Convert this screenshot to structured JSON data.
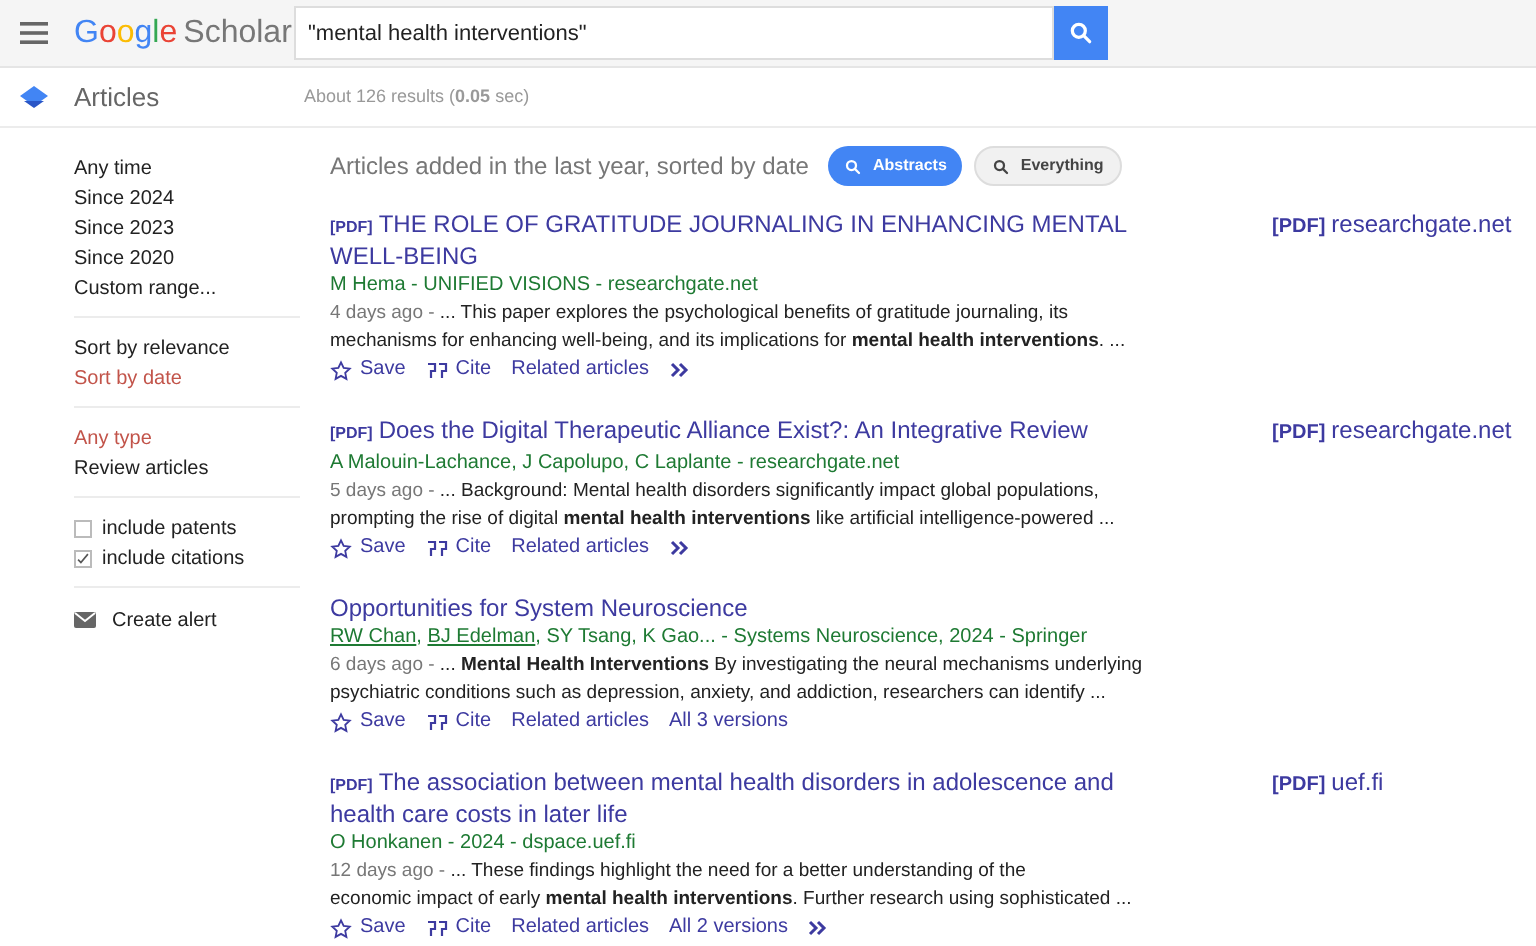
{
  "header": {
    "logo": {
      "brand": "Google",
      "product": "Scholar"
    },
    "search": {
      "value": "\"mental health interventions\""
    }
  },
  "subheader": {
    "section": "Articles",
    "stats": "About 126 results (**0.05** sec)"
  },
  "sidebar": {
    "groups": [
      {
        "kind": "links",
        "items": [
          {
            "label": "Any time",
            "selected": false
          },
          {
            "label": "Since 2024",
            "selected": false
          },
          {
            "label": "Since 2023",
            "selected": false
          },
          {
            "label": "Since 2020",
            "selected": false
          },
          {
            "label": "Custom range...",
            "selected": false
          }
        ]
      },
      {
        "kind": "links",
        "items": [
          {
            "label": "Sort by relevance",
            "selected": false
          },
          {
            "label": "Sort by date",
            "selected": true
          }
        ]
      },
      {
        "kind": "links",
        "items": [
          {
            "label": "Any type",
            "selected": true
          },
          {
            "label": "Review articles",
            "selected": false
          }
        ]
      },
      {
        "kind": "checks",
        "items": [
          {
            "label": "include patents",
            "checked": false
          },
          {
            "label": "include citations",
            "checked": true
          }
        ]
      },
      {
        "kind": "alert",
        "items": [
          {
            "label": "Create alert"
          }
        ]
      }
    ]
  },
  "results_header": {
    "text": "Articles added in the last year, sorted by date",
    "filters": [
      {
        "label": "Abstracts",
        "selected": true
      },
      {
        "label": "Everything",
        "selected": false
      }
    ]
  },
  "results": [
    {
      "tag": "[PDF]",
      "title": "THE ROLE OF GRATITUDE JOURNALING IN ENHANCING MENTAL WELL-BEING",
      "authors": [
        {
          "text": "M Hema - UNIFIED VISIONS - researchgate.net",
          "linked": false
        }
      ],
      "age": "4 days ago - ",
      "snippet_lines": [
        "... This paper explores the psychological benefits of gratitude journaling, its",
        "mechanisms for enhancing well-being, and its implications for **mental health interventions**. ..."
      ],
      "actions": [
        "Save",
        "Cite",
        "Related articles"
      ],
      "more": true,
      "side": {
        "tag": "[PDF]",
        "domain": "researchgate.net"
      }
    },
    {
      "tag": "[PDF]",
      "title": "Does the Digital Therapeutic Alliance Exist?: An Integrative Review",
      "authors": [
        {
          "text": "A Malouin-Lachance, J Capolupo, C Laplante - researchgate.net",
          "linked": false
        }
      ],
      "age": "5 days ago - ",
      "snippet_lines": [
        "... Background: Mental health disorders significantly impact global populations,",
        "prompting the rise of digital **mental health interventions** like artificial intelligence-powered ..."
      ],
      "actions": [
        "Save",
        "Cite",
        "Related articles"
      ],
      "more": true,
      "side": {
        "tag": "[PDF]",
        "domain": "researchgate.net"
      }
    },
    {
      "title": "Opportunities for System Neuroscience",
      "authors": [
        {
          "text": "RW Chan",
          "linked": true
        },
        {
          "text": ", ",
          "linked": false
        },
        {
          "text": "BJ Edelman",
          "linked": true
        },
        {
          "text": ", SY Tsang, K Gao... - Systems Neuroscience, 2024 - Springer",
          "linked": false
        }
      ],
      "age": "6 days ago - ",
      "snippet_lines": [
        "... **Mental Health Interventions** By investigating the neural mechanisms underlying",
        "psychiatric conditions such as depression, anxiety, and addiction, researchers can identify ..."
      ],
      "actions": [
        "Save",
        "Cite",
        "Related articles",
        "All 3 versions"
      ],
      "more": false
    },
    {
      "tag": "[PDF]",
      "title": "The association between mental health disorders in adolescence and health care costs in later life",
      "authors": [
        {
          "text": "O Honkanen - 2024 - dspace.uef.fi",
          "linked": false
        }
      ],
      "age": "12 days ago - ",
      "snippet_lines": [
        "... These findings highlight the need for a better understanding of the",
        "economic impact of early **mental health interventions**. Further research using sophisticated ..."
      ],
      "actions": [
        "Save",
        "Cite",
        "Related articles",
        "All 2 versions"
      ],
      "more": true,
      "side": {
        "tag": "[PDF]",
        "domain": "uef.fi"
      }
    }
  ]
}
